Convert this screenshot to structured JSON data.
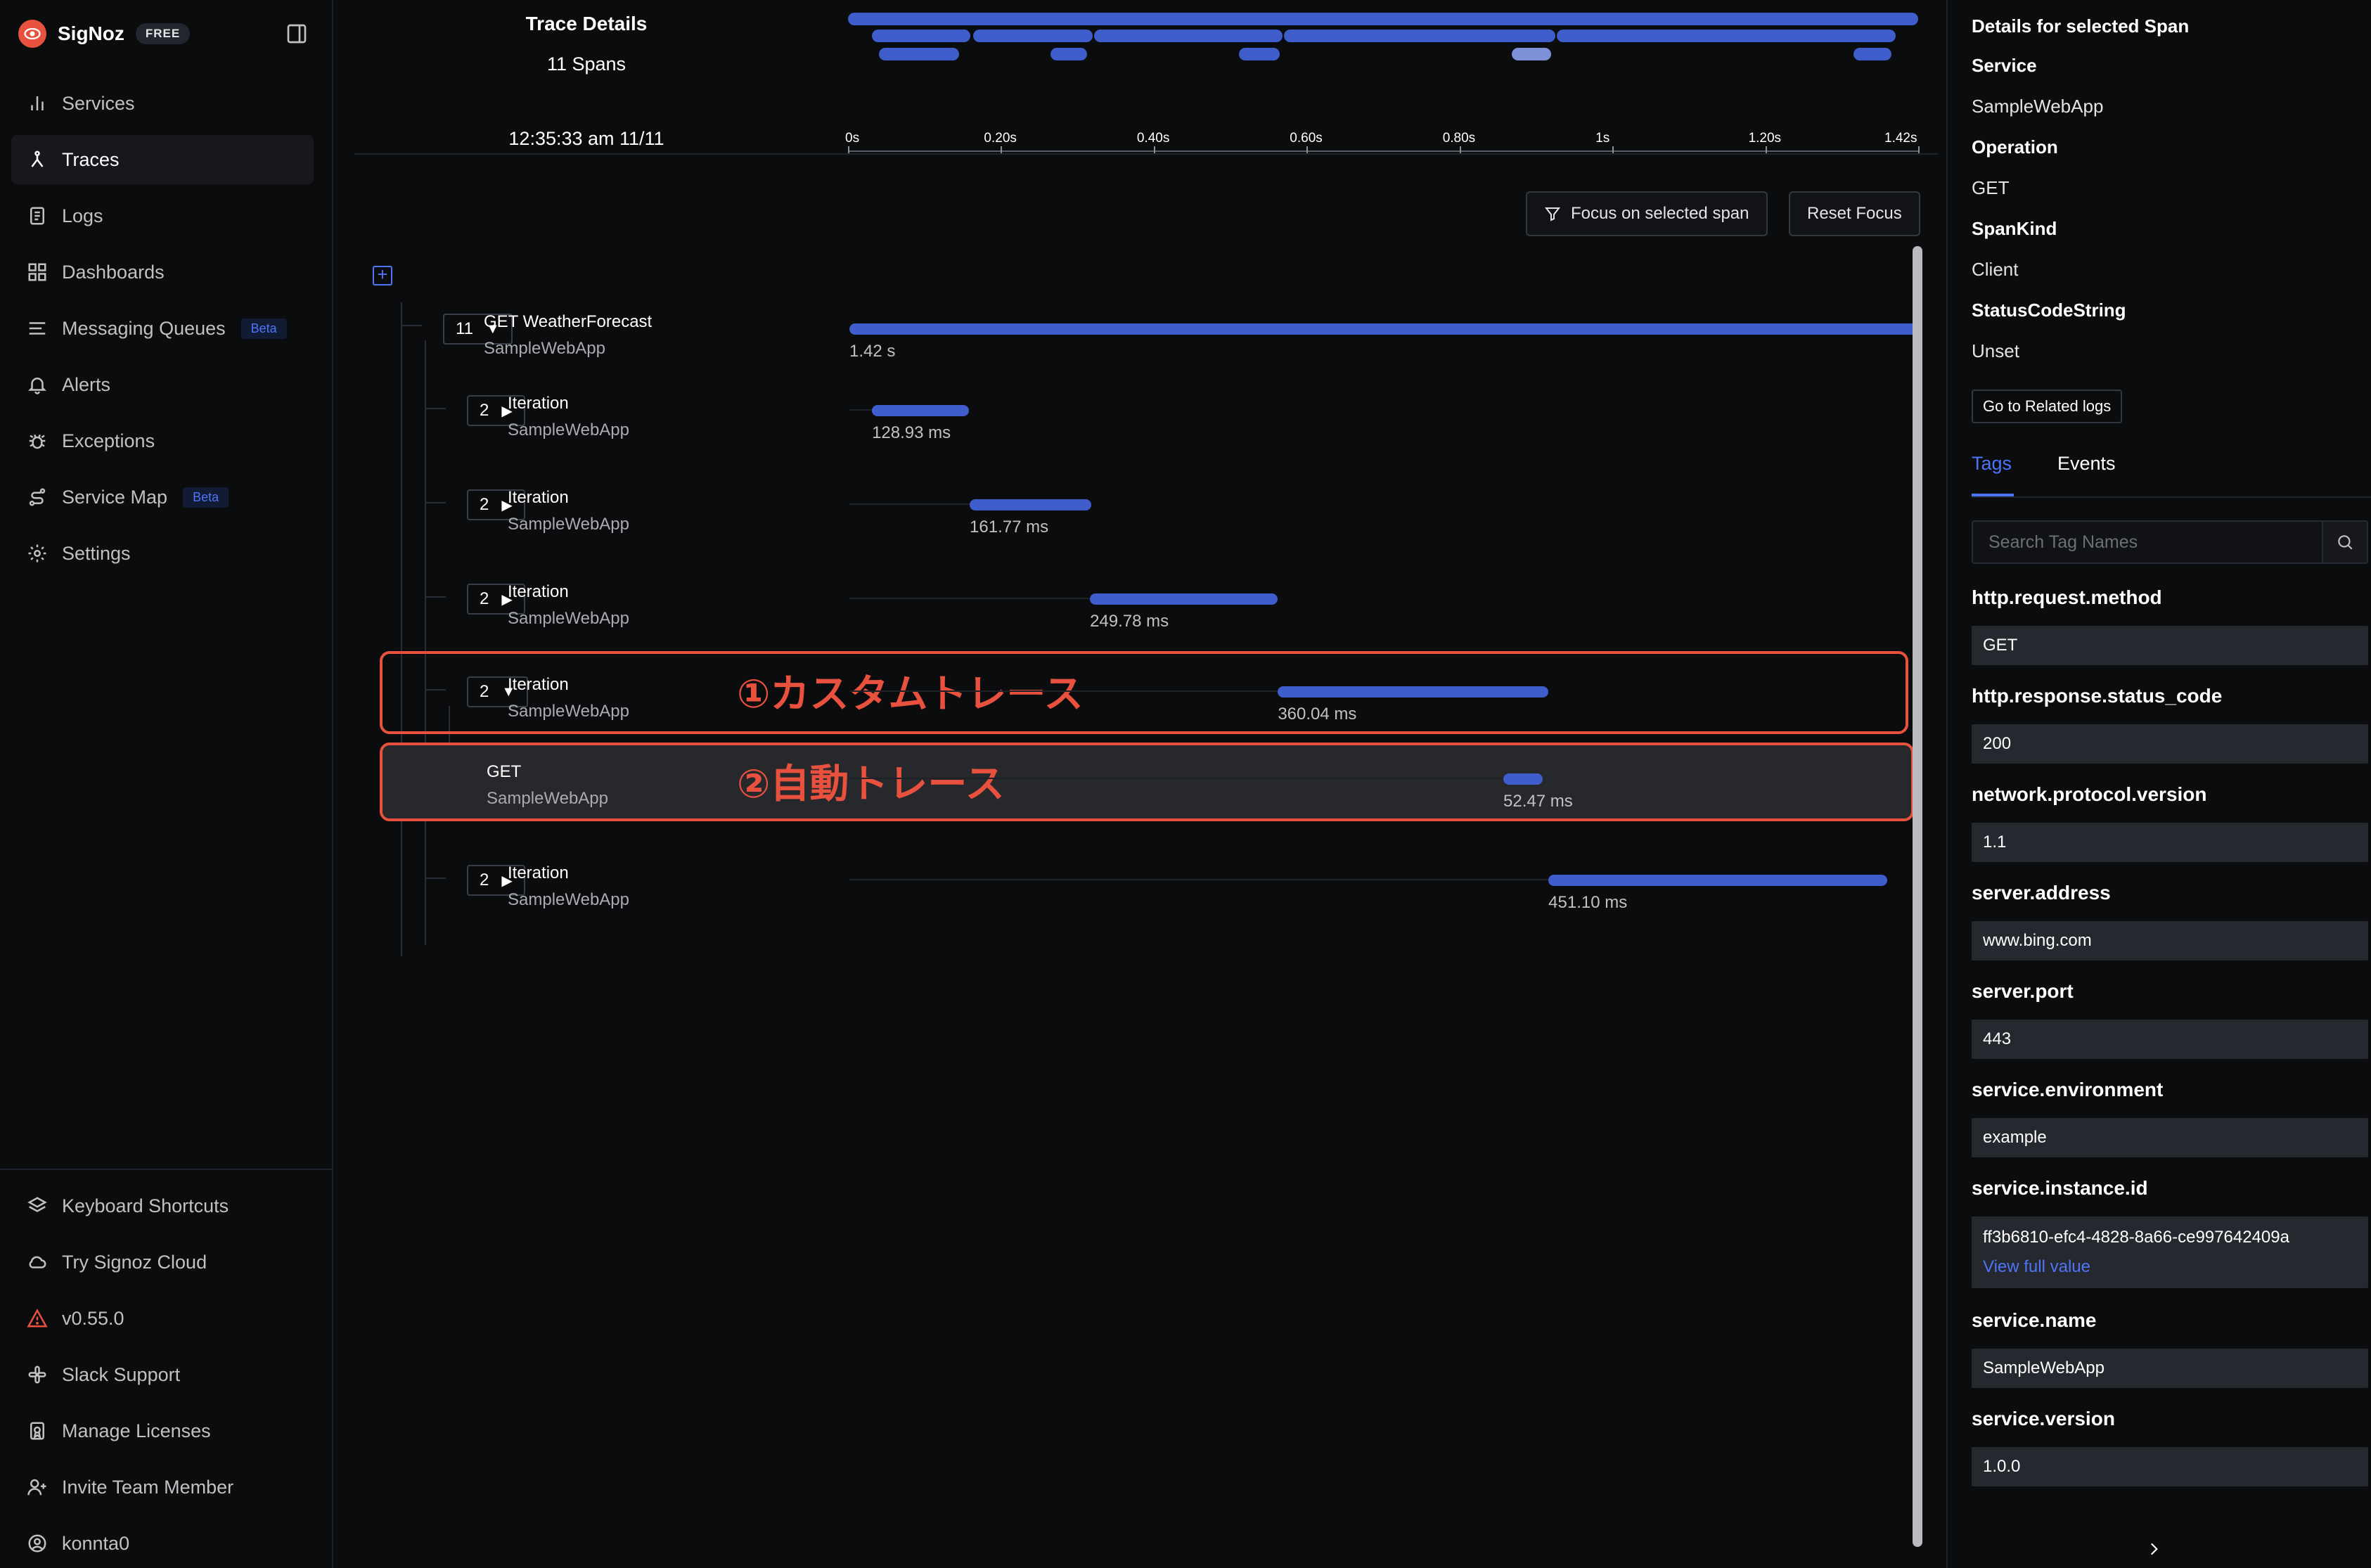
{
  "sidebar": {
    "brand": "SigNoz",
    "plan_badge": "FREE",
    "items": [
      {
        "label": "Services",
        "icon": "bar-chart-icon"
      },
      {
        "label": "Traces",
        "icon": "route-icon"
      },
      {
        "label": "Logs",
        "icon": "scroll-text-icon"
      },
      {
        "label": "Dashboards",
        "icon": "layout-grid-icon"
      },
      {
        "label": "Messaging Queues",
        "icon": "list-minus-icon",
        "badge": "Beta"
      },
      {
        "label": "Alerts",
        "icon": "bell-icon"
      },
      {
        "label": "Exceptions",
        "icon": "bug-icon"
      },
      {
        "label": "Service Map",
        "icon": "route-map-icon",
        "badge": "Beta"
      },
      {
        "label": "Settings",
        "icon": "gear-icon"
      }
    ],
    "bottom_items": [
      {
        "label": "Keyboard Shortcuts",
        "icon": "layers-icon"
      },
      {
        "label": "Try Signoz Cloud",
        "icon": "cloud-icon"
      },
      {
        "label": "v0.55.0",
        "icon": "warning-icon"
      },
      {
        "label": "Slack Support",
        "icon": "slack-icon"
      },
      {
        "label": "Manage Licenses",
        "icon": "license-icon"
      },
      {
        "label": "Invite Team Member",
        "icon": "user-plus-icon"
      },
      {
        "label": "konnta0",
        "icon": "user-circle-icon"
      }
    ]
  },
  "trace": {
    "title": "Trace Details",
    "span_count": "11 Spans",
    "timestamp": "12:35:33 am 11/11",
    "ticks": [
      "0s",
      "0.20s",
      "0.40s",
      "0.60s",
      "0.80s",
      "1s",
      "1.20s",
      "1.42s"
    ],
    "focus_button": "Focus on selected span",
    "reset_button": "Reset Focus",
    "spans": [
      {
        "count": "11",
        "expanded": true,
        "name": "GET WeatherForecast",
        "service": "SampleWebApp",
        "duration": "1.42 s",
        "start_s": 0,
        "duration_s": 1.42
      },
      {
        "count": "2",
        "expanded": false,
        "name": "Iteration",
        "service": "SampleWebApp",
        "duration": "128.93 ms",
        "start_s": 0.03,
        "duration_s": 0.129
      },
      {
        "count": "2",
        "expanded": false,
        "name": "Iteration",
        "service": "SampleWebApp",
        "duration": "161.77 ms",
        "start_s": 0.16,
        "duration_s": 0.162
      },
      {
        "count": "2",
        "expanded": false,
        "name": "Iteration",
        "service": "SampleWebApp",
        "duration": "249.78 ms",
        "start_s": 0.32,
        "duration_s": 0.25
      },
      {
        "count": "2",
        "expanded": true,
        "name": "Iteration",
        "service": "SampleWebApp",
        "duration": "360.04 ms",
        "start_s": 0.57,
        "duration_s": 0.36
      },
      {
        "count": "",
        "expanded": false,
        "name": "GET",
        "service": "SampleWebApp",
        "duration": "52.47 ms",
        "start_s": 0.87,
        "duration_s": 0.052
      },
      {
        "count": "2",
        "expanded": false,
        "name": "Iteration",
        "service": "SampleWebApp",
        "duration": "451.10 ms",
        "start_s": 0.93,
        "duration_s": 0.451
      }
    ],
    "annotations": {
      "custom_trace": "①カスタムトレース",
      "auto_trace": "②自動トレース"
    }
  },
  "details": {
    "title": "Details for selected Span",
    "fields": [
      {
        "key": "Service",
        "value": "SampleWebApp"
      },
      {
        "key": "Operation",
        "value": "GET"
      },
      {
        "key": "SpanKind",
        "value": "Client"
      },
      {
        "key": "StatusCodeString",
        "value": "Unset"
      }
    ],
    "related_logs_button": "Go to Related logs",
    "tabs": [
      "Tags",
      "Events"
    ],
    "search_placeholder": "Search Tag Names",
    "tags": [
      {
        "key": "http.request.method",
        "value": "GET"
      },
      {
        "key": "http.response.status_code",
        "value": "200"
      },
      {
        "key": "network.protocol.version",
        "value": "1.1"
      },
      {
        "key": "server.address",
        "value": "www.bing.com"
      },
      {
        "key": "server.port",
        "value": "443"
      },
      {
        "key": "service.environment",
        "value": "example"
      },
      {
        "key": "service.instance.id",
        "value": "ff3b6810-efc4-4828-8a66-ce997642409a",
        "link": "View full value"
      },
      {
        "key": "service.name",
        "value": "SampleWebApp"
      },
      {
        "key": "service.version",
        "value": "1.0.0"
      }
    ]
  },
  "colors": {
    "accent": "#4e74f8",
    "bar": "#3f5ecc",
    "highlight": "#e8513e",
    "background": "#0b0c0e"
  }
}
